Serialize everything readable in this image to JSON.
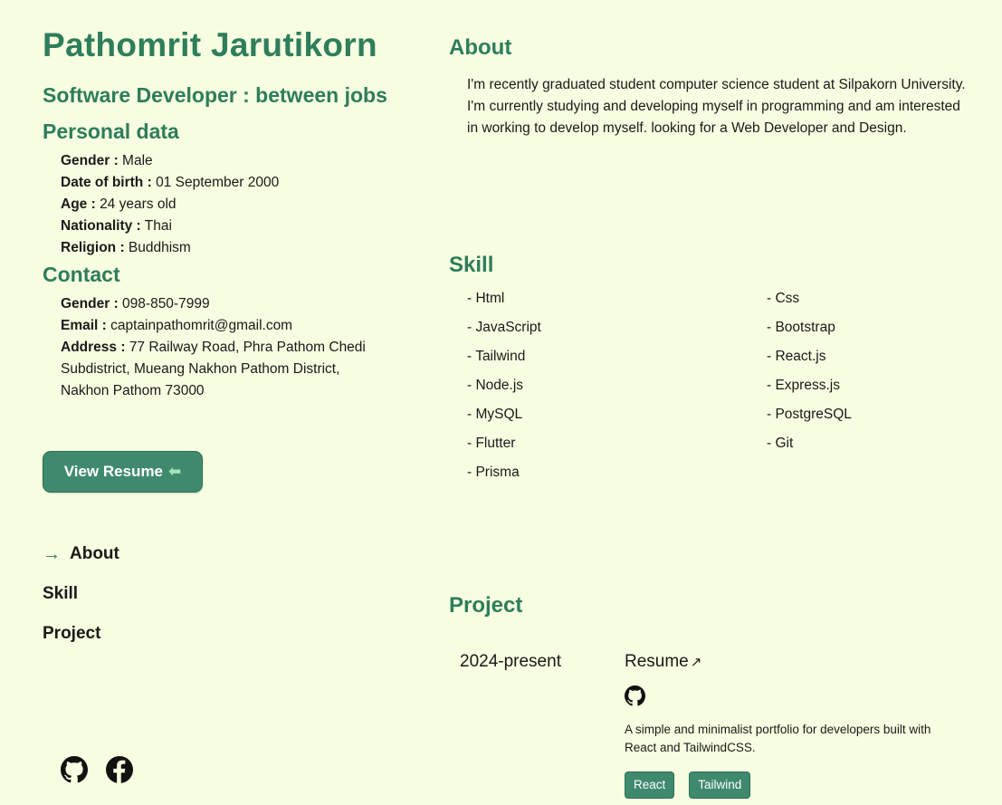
{
  "profile": {
    "name": "Pathomrit Jarutikorn",
    "role": "Software Developer : between jobs"
  },
  "personal": {
    "heading": "Personal data",
    "items": [
      {
        "label": "Gender :",
        "value": "Male"
      },
      {
        "label": "Date of birth :",
        "value": "01 September 2000"
      },
      {
        "label": "Age :",
        "value": "24 years old"
      },
      {
        "label": "Nationality :",
        "value": "Thai"
      },
      {
        "label": "Religion :",
        "value": "Buddhism"
      }
    ]
  },
  "contact": {
    "heading": "Contact",
    "items": [
      {
        "label": "Gender :",
        "value": "098-850-7999"
      },
      {
        "label": "Email :",
        "value": "captainpathomrit@gmail.com"
      },
      {
        "label": "Address :",
        "value": "77 Railway Road, Phra Pathom Chedi Subdistrict, Mueang Nakhon Pathom District, Nakhon Pathom 73000"
      }
    ]
  },
  "resume_button": {
    "label": "View Resume",
    "icon": "left-arrow-icon"
  },
  "nav": {
    "items": [
      {
        "label": "About",
        "active": true
      },
      {
        "label": "Skill",
        "active": false
      },
      {
        "label": "Project",
        "active": false
      }
    ]
  },
  "socials": [
    "github-icon",
    "facebook-icon"
  ],
  "about": {
    "heading": "About",
    "text": "I'm recently graduated student computer science student at Silpakorn University. I'm currently studying and developing myself in programming and am interested in working to develop myself. looking for a Web Developer and Design."
  },
  "skill": {
    "heading": "Skill",
    "items": [
      "- Html",
      "- Css",
      "- JavaScript",
      "- Bootstrap",
      "- Tailwind",
      "- React.js",
      "- Node.js",
      "- Express.js",
      "- MySQL",
      "- PostgreSQL",
      "- Flutter",
      "- Git",
      "- Prisma"
    ]
  },
  "project": {
    "heading": "Project",
    "items": [
      {
        "year": "2024-present",
        "title": "Resume",
        "description": "A simple and minimalist portfolio for developers built with React and TailwindCSS.",
        "tags": [
          "React",
          "Tailwind"
        ]
      }
    ]
  },
  "colors": {
    "background": "#f6fde0",
    "accent": "#2e7d5b",
    "button": "#3f8a6f"
  }
}
